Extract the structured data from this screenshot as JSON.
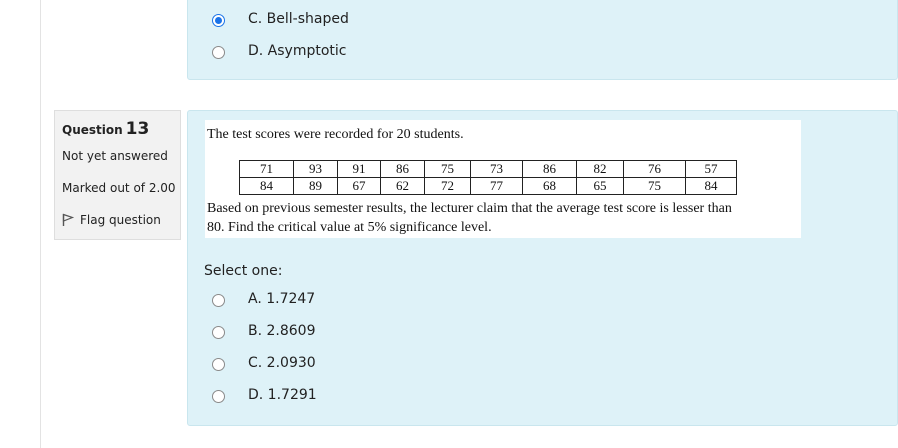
{
  "previous_question": {
    "options": [
      {
        "label": "C. Bell-shaped",
        "checked": true
      },
      {
        "label": "D. Asymptotic",
        "checked": false
      }
    ]
  },
  "question_info": {
    "label": "Question",
    "number": "13",
    "status": "Not yet answered",
    "marks": "Marked out of 2.00",
    "flag_label": "Flag question"
  },
  "question": {
    "intro": "The test scores were recorded for 20 students.",
    "scores_table": [
      [
        "71",
        "93",
        "91",
        "86",
        "75",
        "73",
        "86",
        "82",
        "76",
        "57"
      ],
      [
        "84",
        "89",
        "67",
        "62",
        "72",
        "77",
        "68",
        "65",
        "75",
        "84"
      ]
    ],
    "text_line1": "Based on previous semester results, the lecturer claim that the average test score is lesser than",
    "text_line2": "80. Find the critical value at 5% significance level.",
    "select_prompt": "Select one:",
    "options": [
      {
        "label": "A. 1.7247",
        "checked": false
      },
      {
        "label": "B. 2.8609",
        "checked": false
      },
      {
        "label": "C. 2.0930",
        "checked": false
      },
      {
        "label": "D. 1.7291",
        "checked": false
      }
    ]
  },
  "colors": {
    "panel_bg": "#def2f8",
    "radio_selected": "#1a73e8",
    "info_bg": "#f2f2f2"
  }
}
